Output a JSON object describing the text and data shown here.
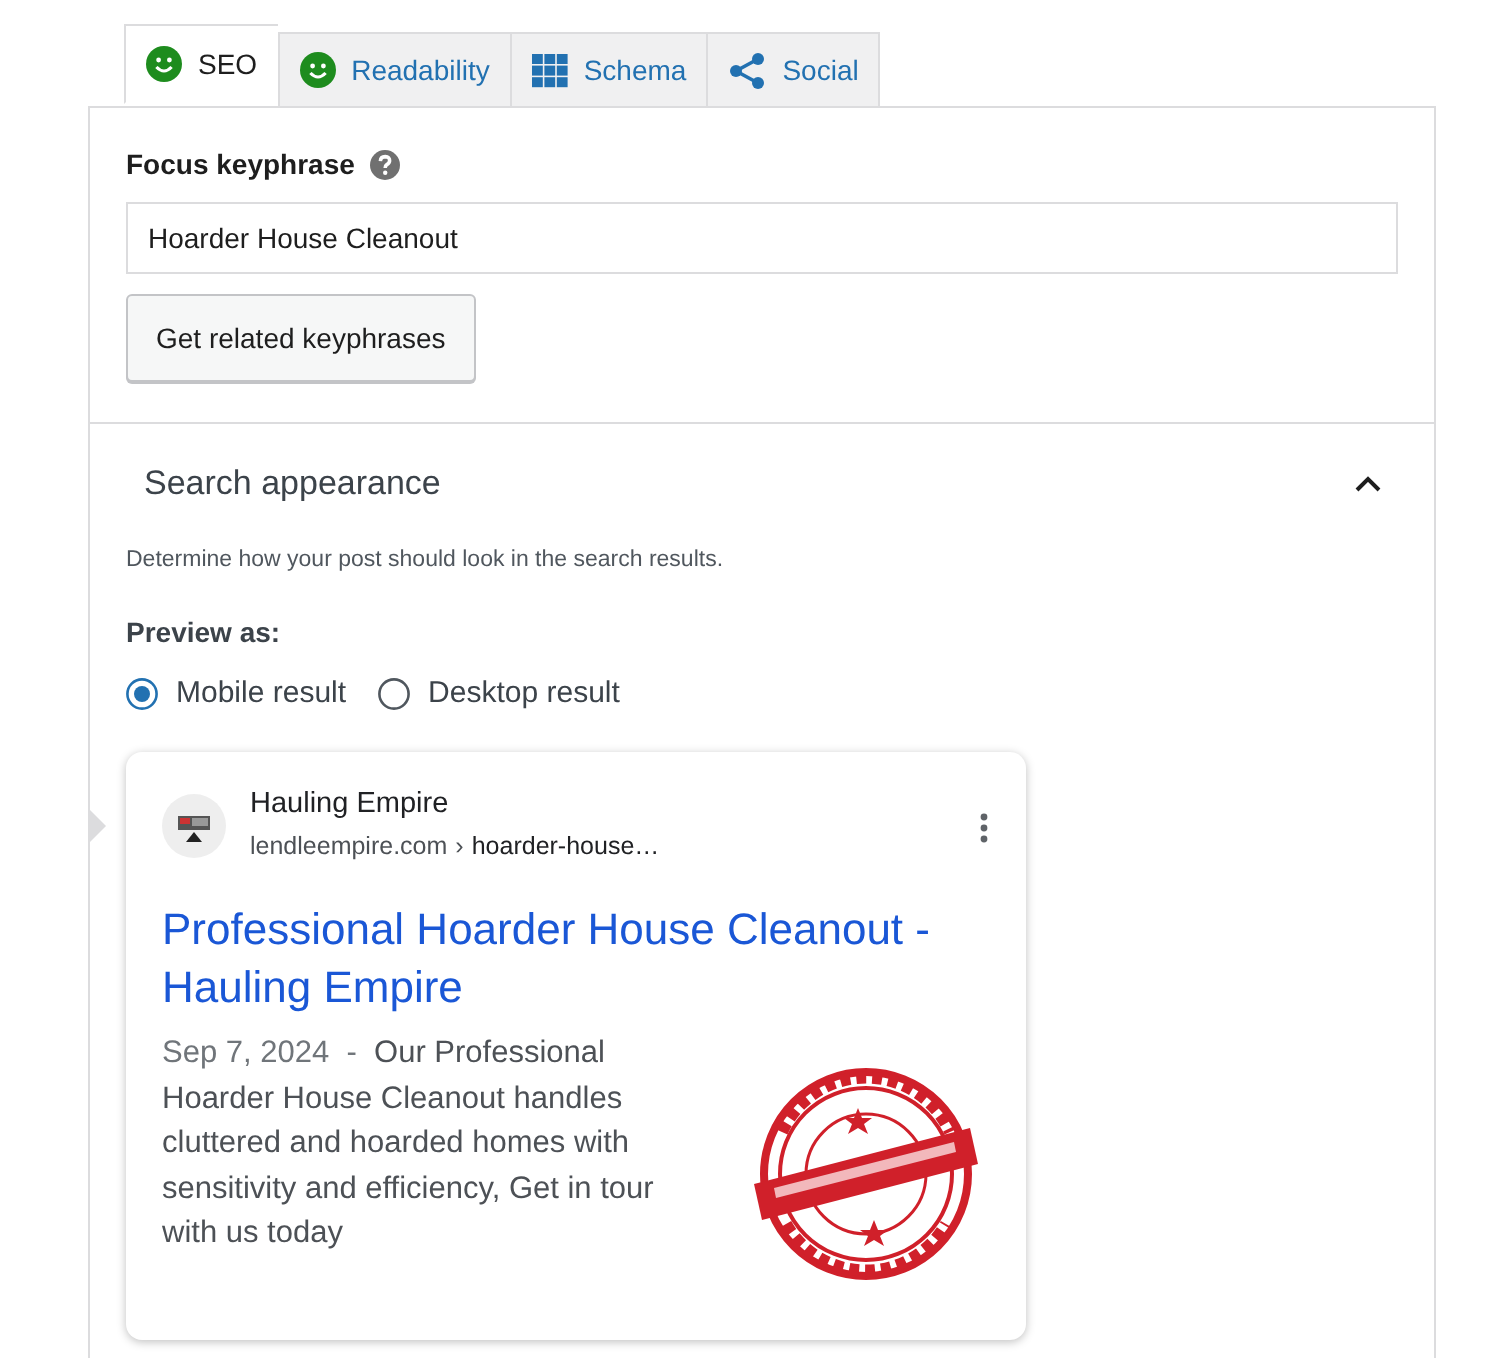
{
  "tabs": [
    {
      "label": "SEO",
      "kind": "smiley",
      "selected": true
    },
    {
      "label": "Readability",
      "kind": "smiley",
      "selected": false
    },
    {
      "label": "Schema",
      "kind": "grid",
      "selected": false
    },
    {
      "label": "Social",
      "kind": "share",
      "selected": false
    }
  ],
  "focus_keyphrase": {
    "label": "Focus keyphrase",
    "value": "Hoarder House Cleanout",
    "button": "Get related keyphrases"
  },
  "search_appearance": {
    "title": "Search appearance",
    "expanded": true,
    "description": "Determine how your post should look in the search results.",
    "preview_label": "Preview as:",
    "options": [
      {
        "label": "Mobile result",
        "selected": true
      },
      {
        "label": "Desktop result",
        "selected": false
      }
    ],
    "preview": {
      "site_name": "Hauling Empire",
      "url": "lendleempire.com",
      "separator": "›",
      "path": "hoarder-house…",
      "title": "Professional Hoarder House Cleanout - Hauling Empire",
      "date": "Sep 7, 2024",
      "date_separator": "-",
      "snippet": "Our Professional Hoarder House Cleanout handles cluttered and hoarded homes with sensitivity and efficiency, Get in tour with us today"
    }
  }
}
